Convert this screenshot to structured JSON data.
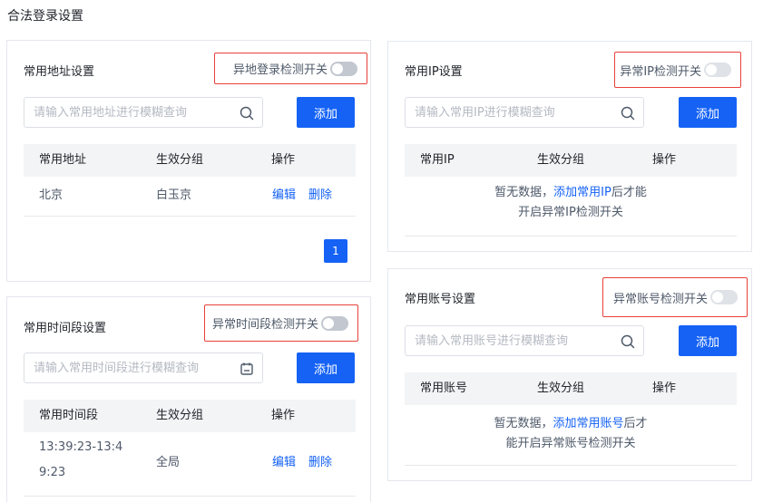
{
  "page": {
    "title": "合法登录设置"
  },
  "address_card": {
    "title": "常用地址设置",
    "switch_label": "异地登录检测开关",
    "search_placeholder": "请输入常用地址进行模糊查询",
    "add_label": "添加",
    "columns": [
      "常用地址",
      "生效分组",
      "操作"
    ],
    "rows": [
      {
        "address": "北京",
        "group": "白玉京",
        "edit": "编辑",
        "delete": "删除"
      }
    ],
    "page_number": "1"
  },
  "time_card": {
    "title": "常用时间段设置",
    "switch_label": "异常时间段检测开关",
    "search_placeholder": "请输入常用时间段进行模糊查询",
    "add_label": "添加",
    "columns": [
      "常用时间段",
      "生效分组",
      "操作"
    ],
    "rows": [
      {
        "time_line1": "13:39:23-13:4",
        "time_line2": "9:23",
        "group": "全局",
        "edit": "编辑",
        "delete": "删除"
      }
    ]
  },
  "ip_card": {
    "title": "常用IP设置",
    "switch_label": "异常IP检测开关",
    "search_placeholder": "请输入常用IP进行模糊查询",
    "add_label": "添加",
    "columns": [
      "常用IP",
      "生效分组",
      "操作"
    ],
    "empty_prefix": "暂无数据，",
    "empty_link": "添加常用IP",
    "empty_suffix": "后才能",
    "empty_line2": "开启异常IP检测开关"
  },
  "account_card": {
    "title": "常用账号设置",
    "switch_label": "异常账号检测开关",
    "search_placeholder": "请输入常用账号进行模糊查询",
    "add_label": "添加",
    "columns": [
      "常用账号",
      "生效分组",
      "操作"
    ],
    "empty_prefix": "暂无数据，",
    "empty_link": "添加常用账号",
    "empty_suffix": "后才",
    "empty_line2": "能开启异常账号检测开关"
  },
  "colors": {
    "accent": "#1562f5",
    "highlight_border": "#e8413a",
    "toggle_off": "#c2c7d0"
  },
  "icons": {
    "search": "search-icon",
    "calendar": "calendar-icon"
  }
}
